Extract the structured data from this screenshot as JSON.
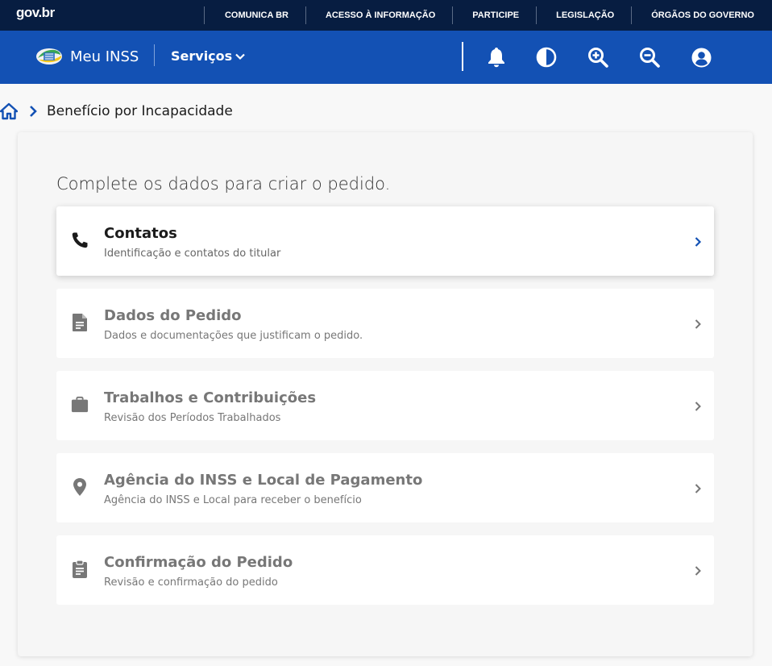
{
  "govbar": {
    "logo": "gov.br",
    "links": [
      "COMUNICA BR",
      "ACESSO À INFORMAÇÃO",
      "PARTICIPE",
      "LEGISLAÇÃO",
      "ÓRGÃOS DO GOVERNO"
    ]
  },
  "header": {
    "app_name": "Meu INSS",
    "menu_label": "Serviços",
    "icons": [
      "bell-icon",
      "contrast-icon",
      "zoom-in-icon",
      "zoom-out-icon",
      "user-icon"
    ]
  },
  "breadcrumb": {
    "current": "Benefício por Incapacidade"
  },
  "form": {
    "title": "Complete os dados para criar o pedido.",
    "steps": [
      {
        "title": "Contatos",
        "subtitle": "Identificação e contatos do titular",
        "icon": "phone-icon",
        "active": true
      },
      {
        "title": "Dados do Pedido",
        "subtitle": "Dados e documentações que justificam o pedido.",
        "icon": "document-icon",
        "active": false
      },
      {
        "title": "Trabalhos e Contribuições",
        "subtitle": "Revisão dos Períodos Trabalhados",
        "icon": "briefcase-icon",
        "active": false
      },
      {
        "title": "Agência do INSS e Local de Pagamento",
        "subtitle": "Agência do INSS e Local para receber o benefício",
        "icon": "location-pin-icon",
        "active": false
      },
      {
        "title": "Confirmação do Pedido",
        "subtitle": "Revisão e confirmação do pedido",
        "icon": "clipboard-icon",
        "active": false
      }
    ]
  },
  "colors": {
    "govbar_bg": "#071d41",
    "header_bg": "#1351b4",
    "accent": "#1351b4"
  }
}
